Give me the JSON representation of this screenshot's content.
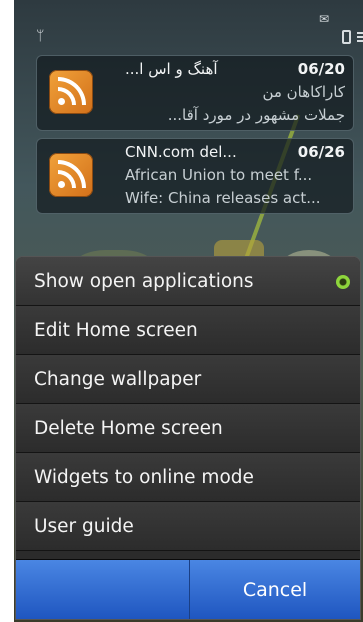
{
  "feeds": [
    {
      "title": "آهنگ و اس ا...",
      "date": "06/20",
      "line2": "کاراکاهان من",
      "line3": "جملات مشهور در مورد آقا..."
    },
    {
      "title": "CNN.com del...",
      "date": "06/26",
      "line2": "African Union to meet f...",
      "line3": "Wife: China releases act..."
    }
  ],
  "menu": {
    "items": [
      "Show open applications",
      "Edit Home screen",
      "Change wallpaper",
      "Delete Home screen",
      "Widgets to online mode",
      "User guide"
    ],
    "cancel_label": "Cancel"
  },
  "colors": {
    "accent": "#2a63cf",
    "active_indicator": "#8ed63c",
    "rss": "#e58a2a"
  },
  "icons": {
    "signal": "signal-antenna-icon",
    "message": "message-icon",
    "battery": "battery-icon",
    "rss": "rss-feed-icon"
  }
}
